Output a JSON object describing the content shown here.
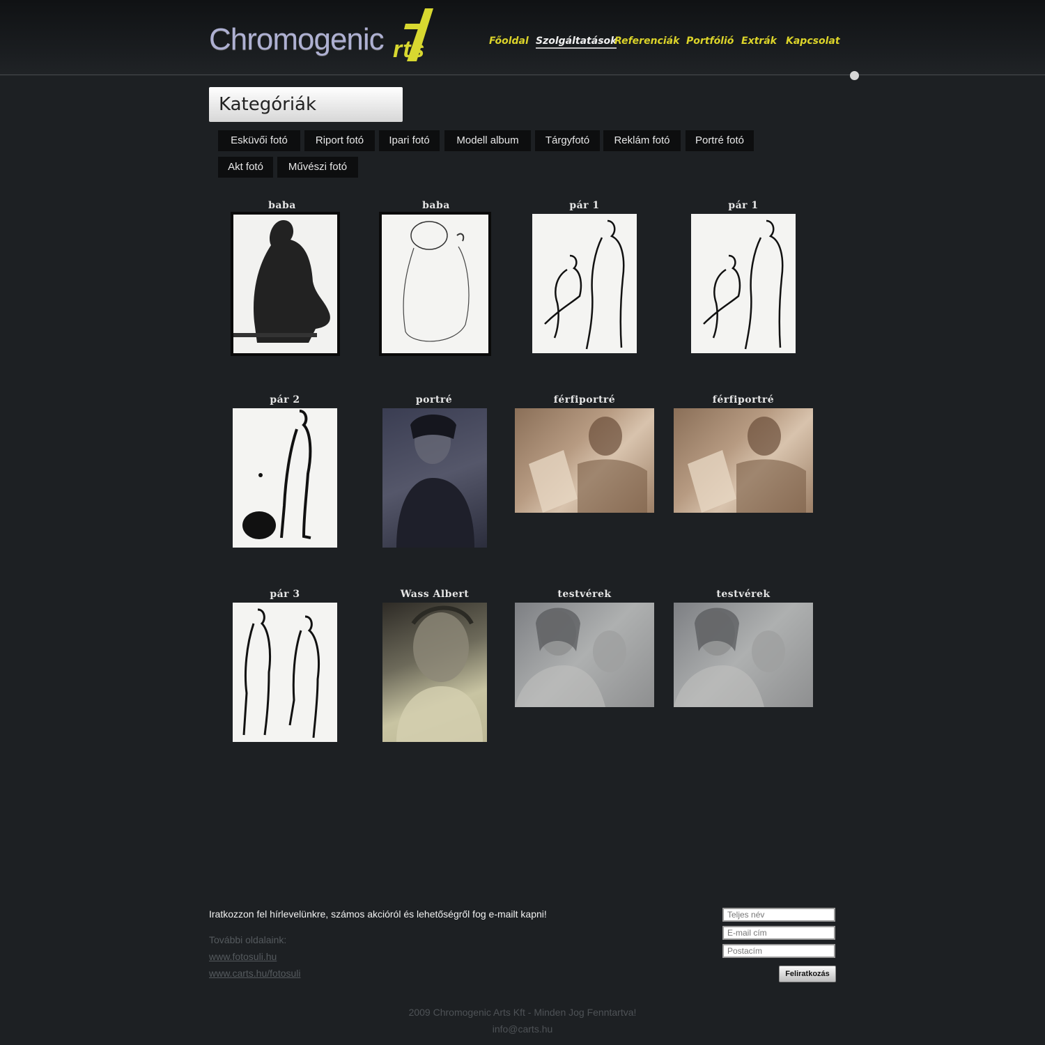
{
  "logo": {
    "main": "Chromogenic",
    "accent": "rts"
  },
  "nav": [
    {
      "label": "Főoldal"
    },
    {
      "label": "Szolgáltatások",
      "active": true
    },
    {
      "label": "Referenciák"
    },
    {
      "label": "Portfólió"
    },
    {
      "label": "Extrák"
    },
    {
      "label": "Kapcsolat"
    }
  ],
  "categories_title": "Kategóriák",
  "categories": [
    "Esküvői fotó",
    "Riport fotó",
    "Ipari fotó",
    "Modell album",
    "Tárgyfotó",
    "Reklám fotó",
    "Portré fotó",
    "Akt fotó",
    "Művészi fotó"
  ],
  "gallery": [
    {
      "title": "baba"
    },
    {
      "title": "baba"
    },
    {
      "title": "pár 1"
    },
    {
      "title": "pár 1"
    },
    {
      "title": "pár 2"
    },
    {
      "title": "portré"
    },
    {
      "title": "férfiportré"
    },
    {
      "title": "férfiportré"
    },
    {
      "title": "pár 3"
    },
    {
      "title": "Wass Albert"
    },
    {
      "title": "testvérek"
    },
    {
      "title": "testvérek"
    }
  ],
  "footer": {
    "newsletter_text": "Iratkozzon fel hírlevelünkre, számos akcióról és lehetőségről fog e-mailt kapni!",
    "more_label": "További oldalaink:",
    "links": [
      "www.fotosuli.hu",
      "www.carts.hu/fotosuli"
    ],
    "fields": {
      "name": "Teljes név",
      "email": "E-mail cím",
      "address": "Postacím"
    },
    "subscribe_label": "Feliratkozás",
    "copyright": "2009 Chromogenic Arts Kft - Minden Jog Fenntartva!",
    "email": "info@carts.hu"
  },
  "colors": {
    "accent": "#dcd42a",
    "background": "#1d2023"
  }
}
